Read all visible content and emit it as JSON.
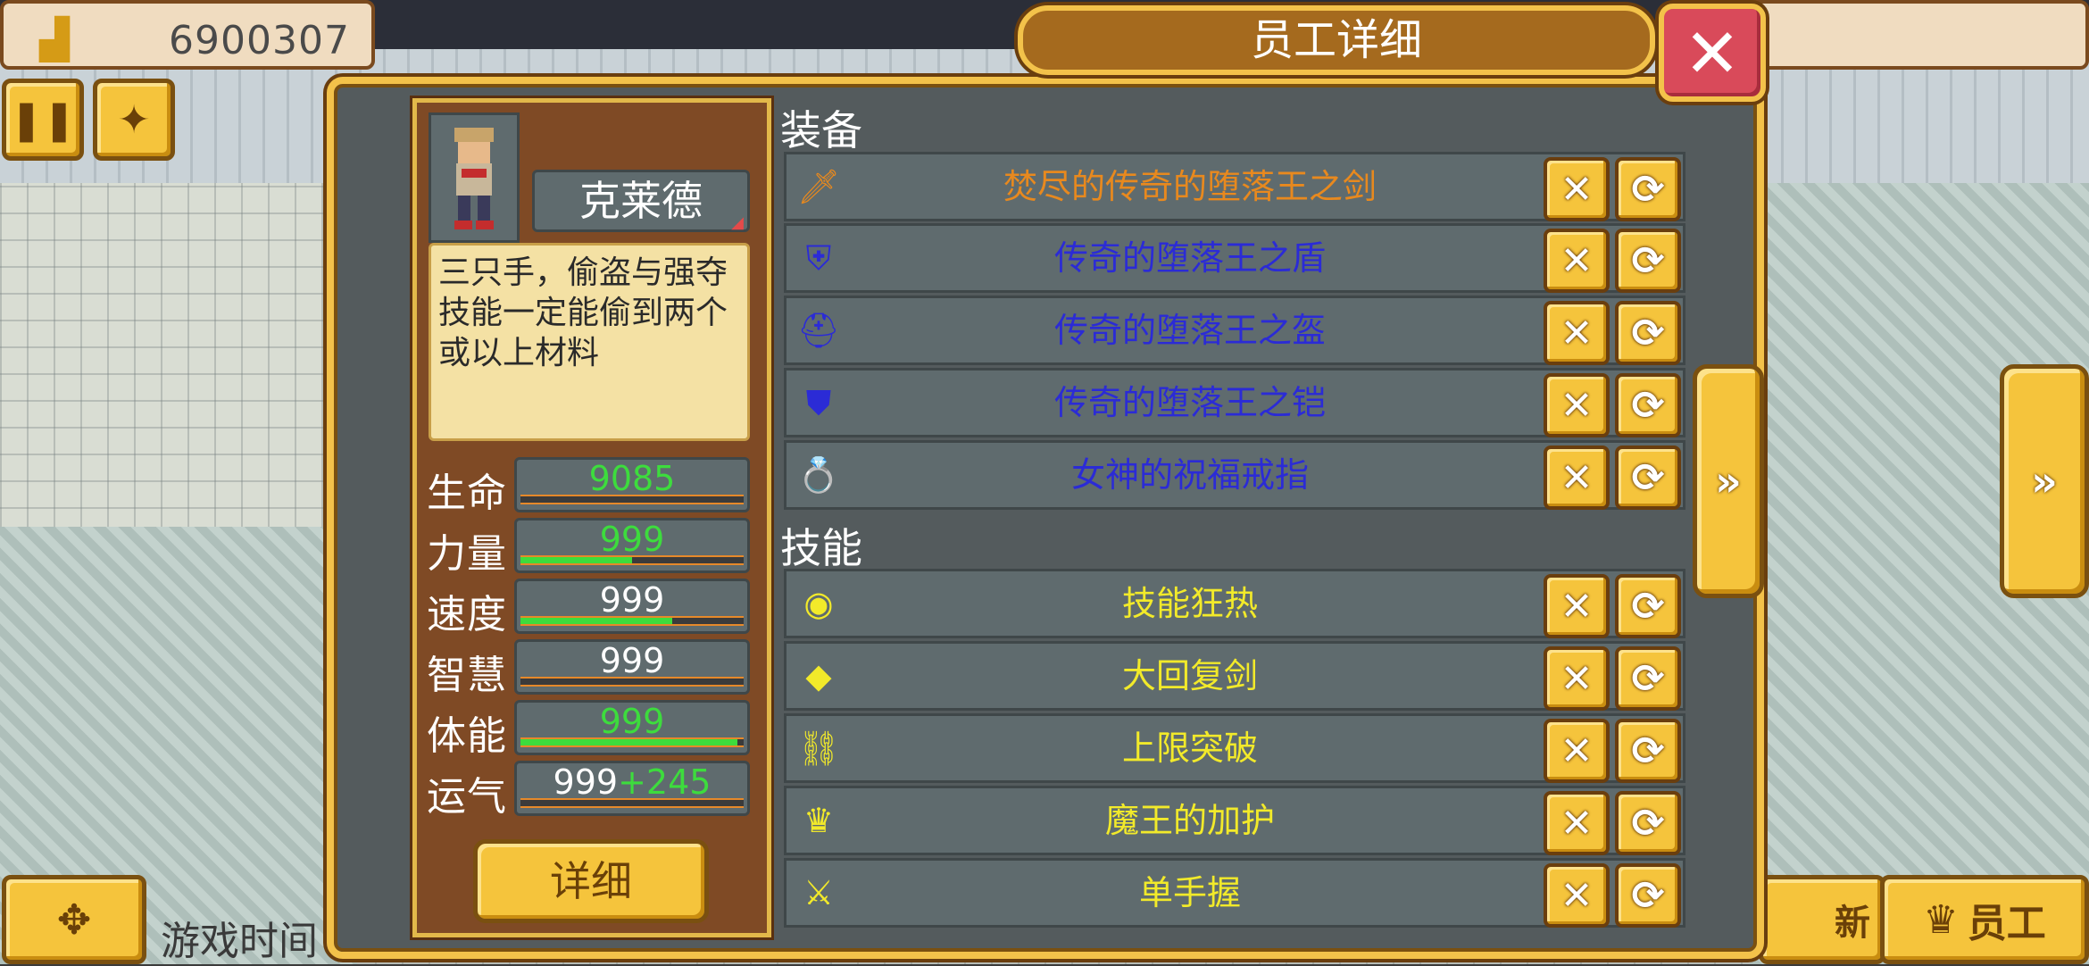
{
  "top": {
    "money_value": "6900307"
  },
  "buttons": {
    "pause_icon": "pause-icon",
    "speed_icon": "fast-forward-icon",
    "move_icon": "move-icon",
    "game_time_label": "游戏时间",
    "book_label": "新",
    "staff_label": "员工"
  },
  "dialog": {
    "title": "员工详细",
    "close_symbol": "✕"
  },
  "character": {
    "name": "克莱德",
    "description": "三只手，偷盗与强夺技能一定能偷到两个或以上材料",
    "stats": [
      {
        "label": "生命",
        "value": "9085",
        "bonus": "",
        "value_color": "#3ddc3d",
        "fill": 0.0
      },
      {
        "label": "力量",
        "value": "999",
        "bonus": "",
        "value_color": "#3ddc3d",
        "fill": 0.5
      },
      {
        "label": "速度",
        "value": "999",
        "bonus": "",
        "value_color": "#ffffff",
        "fill": 0.68
      },
      {
        "label": "智慧",
        "value": "999",
        "bonus": "",
        "value_color": "#ffffff",
        "fill": 0.0
      },
      {
        "label": "体能",
        "value": "999",
        "bonus": "",
        "value_color": "#3ddc3d",
        "fill": 0.97
      },
      {
        "label": "运气",
        "value": "999",
        "bonus": "+245",
        "value_color": "#ffffff",
        "fill": 0.0
      }
    ],
    "detail_button": "详细"
  },
  "equipment": {
    "title": "装备",
    "items": [
      {
        "name": "焚尽的传奇的堕落王之剑",
        "color": "#e8891e",
        "icon": "sword-icon",
        "glyph": "🗡"
      },
      {
        "name": "传奇的堕落王之盾",
        "color": "#2b2bd6",
        "icon": "shield-icon",
        "glyph": "⛨"
      },
      {
        "name": "传奇的堕落王之盔",
        "color": "#2b2bd6",
        "icon": "helmet-icon",
        "glyph": "⛑"
      },
      {
        "name": "传奇的堕落王之铠",
        "color": "#2b2bd6",
        "icon": "armor-icon",
        "glyph": "⛊"
      },
      {
        "name": "女神的祝福戒指",
        "color": "#2b2bd6",
        "icon": "ring-icon",
        "glyph": "💍"
      }
    ]
  },
  "skills": {
    "title": "技能",
    "items": [
      {
        "name": "技能狂热",
        "color": "#f2ea2a",
        "icon": "skill-orb-icon",
        "glyph": "◉"
      },
      {
        "name": "大回复剑",
        "color": "#f2ea2a",
        "icon": "crystal-sword-icon",
        "glyph": "◆"
      },
      {
        "name": "上限突破",
        "color": "#f2ea2a",
        "icon": "chain-icon",
        "glyph": "⛓"
      },
      {
        "name": "魔王的加护",
        "color": "#f2ea2a",
        "icon": "demon-king-icon",
        "glyph": "♛"
      },
      {
        "name": "单手握",
        "color": "#f2ea2a",
        "icon": "dagger-icon",
        "glyph": "⚔"
      }
    ]
  },
  "actions": {
    "remove_symbol": "✕",
    "swap_symbol": "⟳"
  }
}
